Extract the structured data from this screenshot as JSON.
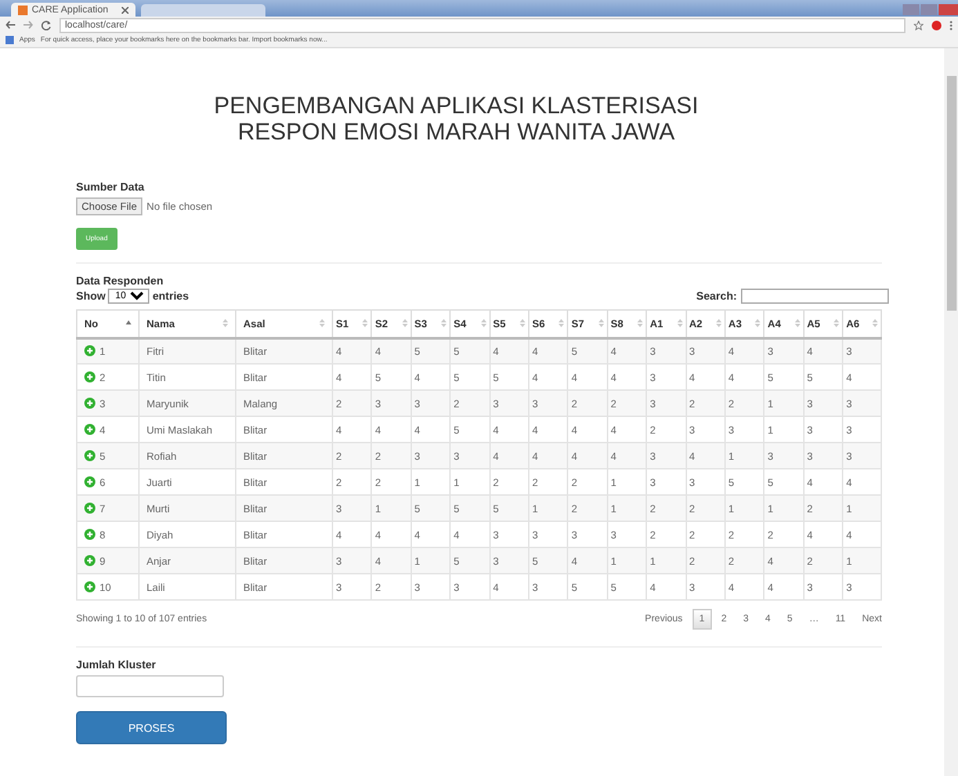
{
  "browser": {
    "tab_title": "CARE Application",
    "address": "localhost/care/",
    "apps_label": "Apps",
    "bookmarks_hint": "For quick access, place your bookmarks here on the bookmarks bar. Import bookmarks now..."
  },
  "title": "PENGEMBANGAN APLIKASI KLASTERISASI RESPON EMOSI MARAH WANITA JAWA",
  "source": {
    "label": "Sumber Data",
    "choose_button": "Choose File",
    "file_status": "No file chosen",
    "upload_button": "Upload"
  },
  "table": {
    "caption": "Data Responden",
    "show_label": "Show",
    "page_size": "10",
    "entries_label": "entries",
    "search_label": "Search:",
    "columns": [
      {
        "label": "No",
        "sorted": true
      },
      {
        "label": "Nama",
        "sorted": false
      },
      {
        "label": "Asal",
        "sorted": false
      },
      {
        "label": "S1",
        "sorted": false
      },
      {
        "label": "S2",
        "sorted": false
      },
      {
        "label": "S3",
        "sorted": false
      },
      {
        "label": "S4",
        "sorted": false
      },
      {
        "label": "S5",
        "sorted": false
      },
      {
        "label": "S6",
        "sorted": false
      },
      {
        "label": "S7",
        "sorted": false
      },
      {
        "label": "S8",
        "sorted": false
      },
      {
        "label": "A1",
        "sorted": false
      },
      {
        "label": "A2",
        "sorted": false
      },
      {
        "label": "A3",
        "sorted": false
      },
      {
        "label": "A4",
        "sorted": false
      },
      {
        "label": "A5",
        "sorted": false
      },
      {
        "label": "A6",
        "sorted": false
      }
    ],
    "rows": [
      [
        "1",
        "Fitri",
        "Blitar",
        "4",
        "4",
        "5",
        "5",
        "4",
        "4",
        "5",
        "4",
        "3",
        "3",
        "4",
        "3",
        "4",
        "3"
      ],
      [
        "2",
        "Titin",
        "Blitar",
        "4",
        "5",
        "4",
        "5",
        "5",
        "4",
        "4",
        "4",
        "3",
        "4",
        "4",
        "5",
        "5",
        "4"
      ],
      [
        "3",
        "Maryunik",
        "Malang",
        "2",
        "3",
        "3",
        "2",
        "3",
        "3",
        "2",
        "2",
        "3",
        "2",
        "2",
        "1",
        "3",
        "3"
      ],
      [
        "4",
        "Umi Maslakah",
        "Blitar",
        "4",
        "4",
        "4",
        "5",
        "4",
        "4",
        "4",
        "4",
        "2",
        "3",
        "3",
        "1",
        "3",
        "3"
      ],
      [
        "5",
        "Rofiah",
        "Blitar",
        "2",
        "2",
        "3",
        "3",
        "4",
        "4",
        "4",
        "4",
        "3",
        "4",
        "1",
        "3",
        "3",
        "3"
      ],
      [
        "6",
        "Juarti",
        "Blitar",
        "2",
        "2",
        "1",
        "1",
        "2",
        "2",
        "2",
        "1",
        "3",
        "3",
        "5",
        "5",
        "4",
        "4"
      ],
      [
        "7",
        "Murti",
        "Blitar",
        "3",
        "1",
        "5",
        "5",
        "5",
        "1",
        "2",
        "1",
        "2",
        "2",
        "1",
        "1",
        "2",
        "1"
      ],
      [
        "8",
        "Diyah",
        "Blitar",
        "4",
        "4",
        "4",
        "4",
        "3",
        "3",
        "3",
        "3",
        "2",
        "2",
        "2",
        "2",
        "4",
        "4"
      ],
      [
        "9",
        "Anjar",
        "Blitar",
        "3",
        "4",
        "1",
        "5",
        "3",
        "5",
        "4",
        "1",
        "1",
        "2",
        "2",
        "4",
        "2",
        "1"
      ],
      [
        "10",
        "Laili",
        "Blitar",
        "3",
        "2",
        "3",
        "3",
        "4",
        "3",
        "5",
        "5",
        "4",
        "3",
        "4",
        "4",
        "3",
        "3"
      ]
    ],
    "info": "Showing 1 to 10 of 107 entries",
    "pagination": [
      {
        "label": "Previous",
        "selected": false
      },
      {
        "label": "1",
        "selected": true
      },
      {
        "label": "2",
        "selected": false
      },
      {
        "label": "3",
        "selected": false
      },
      {
        "label": "4",
        "selected": false
      },
      {
        "label": "5",
        "selected": false
      },
      {
        "label": "…",
        "selected": false
      },
      {
        "label": "11",
        "selected": false
      },
      {
        "label": "Next",
        "selected": false
      }
    ]
  },
  "cluster": {
    "label": "Jumlah Kluster",
    "process_button": "PROSES"
  }
}
